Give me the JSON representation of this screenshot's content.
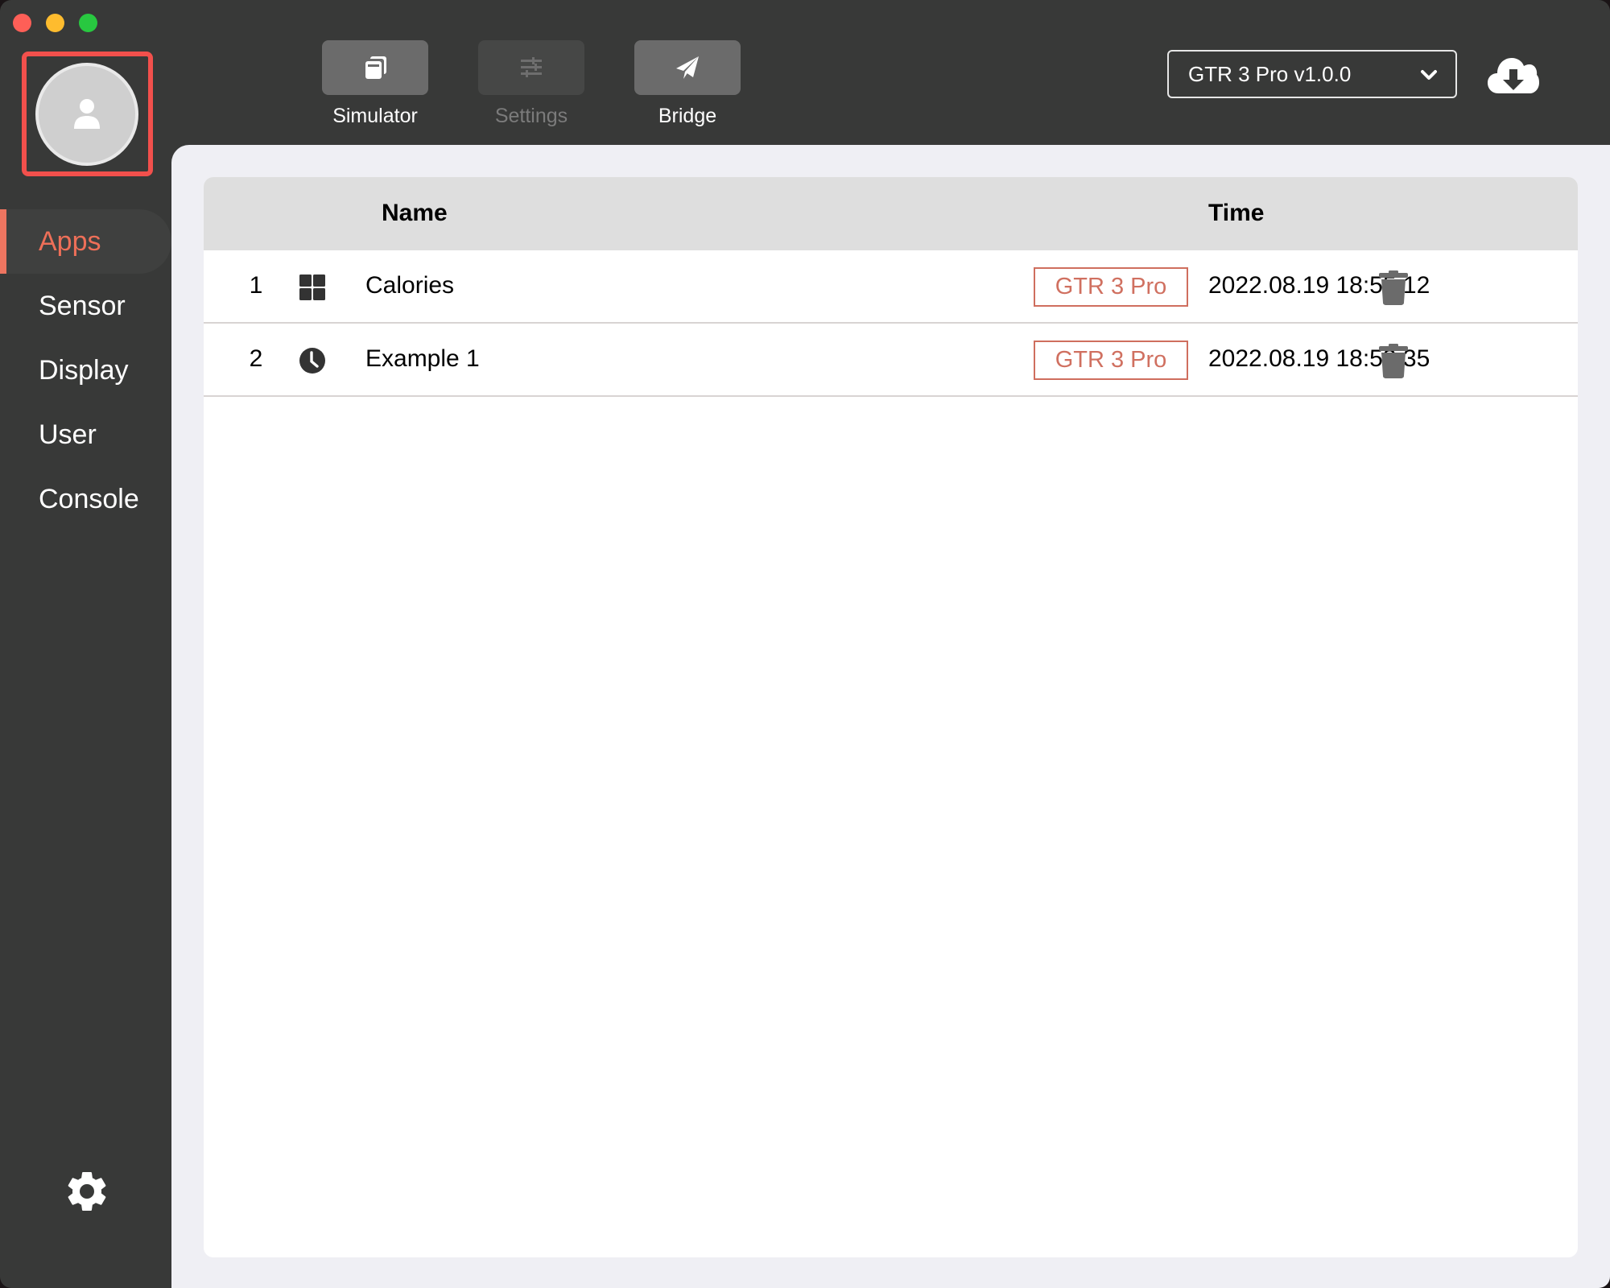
{
  "window": {
    "controls": [
      "close",
      "minimize",
      "maximize"
    ]
  },
  "sidebar": {
    "avatar_icon": "user-icon",
    "items": [
      {
        "label": "Apps",
        "active": true
      },
      {
        "label": "Sensor",
        "active": false
      },
      {
        "label": "Display",
        "active": false
      },
      {
        "label": "User",
        "active": false
      },
      {
        "label": "Console",
        "active": false
      }
    ],
    "footer_icon": "gear-icon",
    "accent_color": "#ee6f58"
  },
  "toolbar": {
    "tools": [
      {
        "label": "Simulator",
        "icon": "simulator-icon",
        "enabled": true
      },
      {
        "label": "Settings",
        "icon": "sliders-icon",
        "enabled": false
      },
      {
        "label": "Bridge",
        "icon": "paper-plane-icon",
        "enabled": true
      }
    ],
    "device_select": {
      "value": "GTR 3 Pro v1.0.0"
    },
    "download_icon": "cloud-download-icon"
  },
  "table": {
    "columns": {
      "name": "Name",
      "time": "Time"
    },
    "rows": [
      {
        "index": "1",
        "icon": "grid-icon",
        "name": "Calories",
        "device": "GTR 3 Pro",
        "time": "2022.08.19 18:55:12"
      },
      {
        "index": "2",
        "icon": "clock-icon",
        "name": "Example 1",
        "device": "GTR 3 Pro",
        "time": "2022.08.19 18:53:35"
      }
    ],
    "badge_color": "#d07060"
  }
}
